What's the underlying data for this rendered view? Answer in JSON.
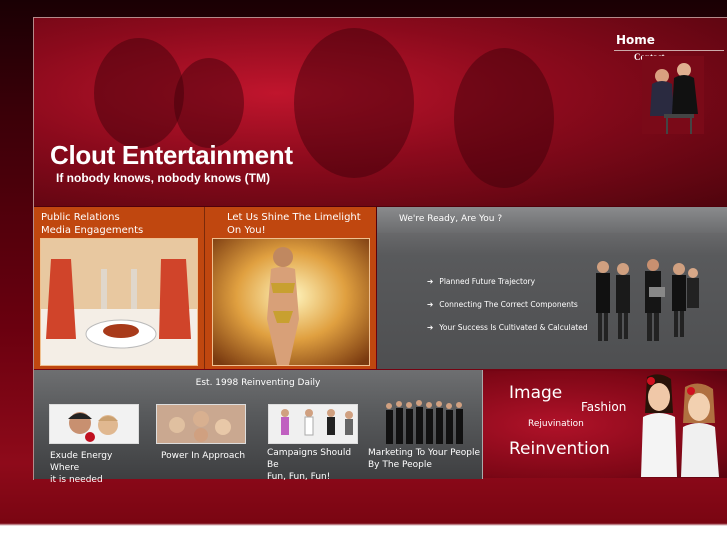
{
  "header": {
    "title": "Clout Entertainment",
    "tagline": "If nobody knows, nobody knows (TM)",
    "nav": {
      "home": "Home",
      "contact": "Contact"
    }
  },
  "panels": {
    "pr": {
      "line1": "Public Relations",
      "line2": "Media Engagements"
    },
    "limelight": {
      "line1": "Let Us Shine The Limelight",
      "line2": "On You!"
    },
    "ready": {
      "title": "We're Ready, Are You ?",
      "bullets": [
        "Planned Future Trajectory",
        "Connecting The Correct Components",
        "Your Success Is Cultivated & Calculated"
      ]
    }
  },
  "bottom": {
    "heading": "Est. 1998 Reinventing Daily",
    "captions": [
      {
        "l1": "Exude Energy",
        "l2": "Where",
        "l3": "it is needed"
      },
      {
        "l1": "Power In Approach"
      },
      {
        "l1": "Campaigns Should",
        "l2": "Be",
        "l3": "Fun, Fun, Fun!"
      },
      {
        "l1": "Marketing To Your People",
        "l2": "By The People"
      }
    ]
  },
  "promo": {
    "w1": "Image",
    "w2": "Fashion",
    "w3": "Rejuvination",
    "w4": "Reinvention"
  },
  "colors": {
    "brand_red": "#8a0a1c",
    "panel_orange": "#c0470f",
    "panel_gray": "#595a5c"
  }
}
